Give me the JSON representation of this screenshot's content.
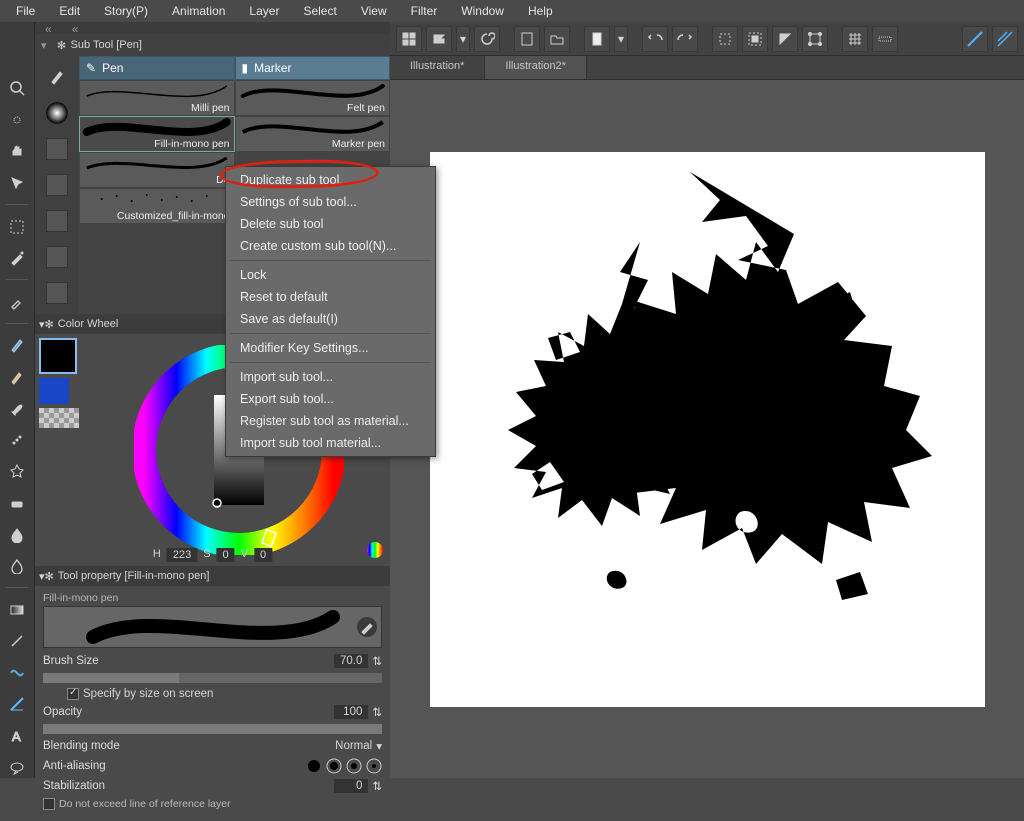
{
  "menu": [
    "File",
    "Edit",
    "Story(P)",
    "Animation",
    "Layer",
    "Select",
    "View",
    "Filter",
    "Window",
    "Help"
  ],
  "subtool": {
    "header": "Sub Tool [Pen]",
    "tabs": {
      "pen": "Pen",
      "marker": "Marker"
    },
    "brushes": {
      "col1": [
        {
          "label": "Milli pen"
        },
        {
          "label": "Fill-in-mono pen"
        },
        {
          "label": "De"
        },
        {
          "label": "Customized_fill-in-mono"
        }
      ],
      "col2": [
        {
          "label": "Felt pen"
        },
        {
          "label": "Marker pen"
        }
      ]
    }
  },
  "context_menu": {
    "items_group1": [
      "Duplicate sub tool...",
      "Settings of sub tool...",
      "Delete sub tool",
      "Create custom sub tool(N)..."
    ],
    "items_group2": [
      "Lock",
      "Reset to default",
      "Save as default(I)"
    ],
    "items_group3": [
      "Modifier Key Settings..."
    ],
    "items_group4": [
      "Import sub tool...",
      "Export sub tool...",
      "Register sub tool as material...",
      "Import sub tool material..."
    ]
  },
  "color_wheel": {
    "title": "Color Wheel",
    "h_label": "H",
    "h_value": "223",
    "s_label": "S",
    "s_value": "0",
    "v_label": "V",
    "v_value": "0"
  },
  "tool_property": {
    "title": "Tool property [Fill-in-mono pen]",
    "preview_label": "Fill-in-mono pen",
    "brush_size_label": "Brush Size",
    "brush_size_value": "70.0",
    "specify_label": "Specify by size on screen",
    "opacity_label": "Opacity",
    "opacity_value": "100",
    "blend_label": "Blending mode",
    "blend_value": "Normal",
    "aa_label": "Anti-aliasing",
    "stab_label": "Stabilization",
    "stab_value": "0",
    "exceed_label": "Do not exceed line of reference layer"
  },
  "doctabs": {
    "a": "Illustration*",
    "b": "Illustration2*"
  }
}
